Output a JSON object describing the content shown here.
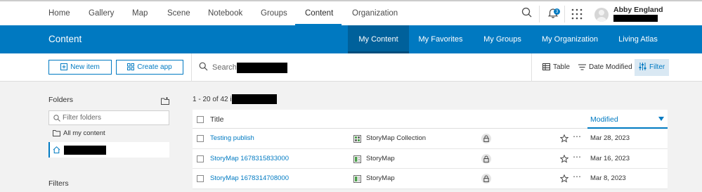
{
  "topnav": {
    "items": [
      "Home",
      "Gallery",
      "Map",
      "Scene",
      "Notebook",
      "Groups",
      "Content",
      "Organization"
    ],
    "active": "Content",
    "notification_count": "3",
    "user_name": "Abby England"
  },
  "header": {
    "title": "Content",
    "tabs": [
      "My Content",
      "My Favorites",
      "My Groups",
      "My Organization",
      "Living Atlas"
    ],
    "active_tab": "My Content"
  },
  "toolbar": {
    "new_item_label": "New item",
    "create_app_label": "Create app",
    "search_placeholder": "Search",
    "table_label": "Table",
    "sort_label": "Date Modified",
    "filter_label": "Filter"
  },
  "sidebar": {
    "folders_heading": "Folders",
    "filter_placeholder": "Filter folders",
    "all_content_label": "All my content",
    "filters_heading": "Filters"
  },
  "list": {
    "count_text": "1 - 20 of 42 in",
    "columns": {
      "title": "Title",
      "modified": "Modified"
    },
    "rows": [
      {
        "title": "Testing publish",
        "type": "StoryMap Collection",
        "modified": "Mar 28, 2023"
      },
      {
        "title": "StoryMap 1678315833000",
        "type": "StoryMap",
        "modified": "Mar 16, 2023"
      },
      {
        "title": "StoryMap 1678314708000",
        "type": "StoryMap",
        "modified": "Mar 8, 2023"
      }
    ]
  },
  "colors": {
    "brand_blue": "#0079c1",
    "link_blue": "#007ac2",
    "active_tab": "#00619b"
  },
  "icons": [
    "search-icon",
    "bell-icon",
    "app-launcher-icon",
    "avatar",
    "new-item-icon",
    "create-app-icon",
    "table-icon",
    "sort-icon",
    "filter-icon",
    "folder-add-icon",
    "folder-icon",
    "home-icon",
    "storymap-collection-icon",
    "storymap-icon",
    "lock-icon",
    "star-icon",
    "more-icon"
  ]
}
